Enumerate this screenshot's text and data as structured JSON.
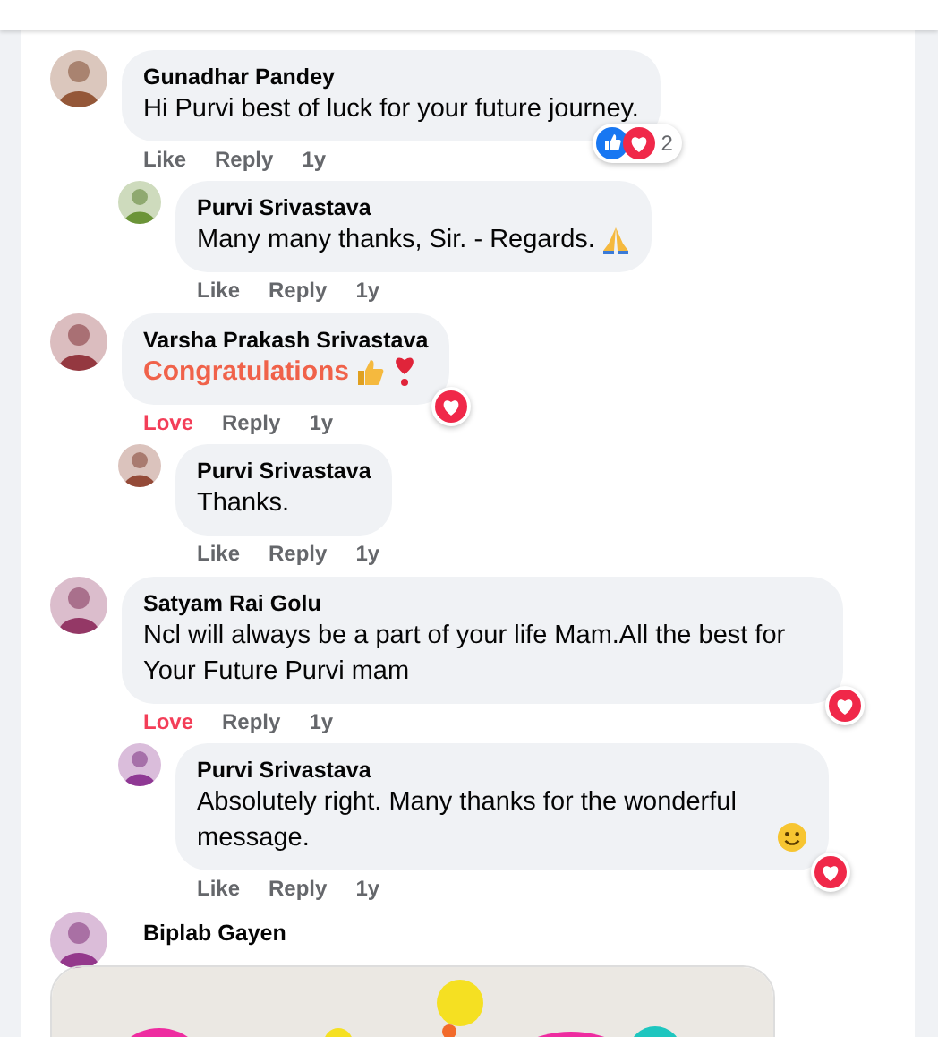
{
  "comments": [
    {
      "author": "Gunadhar Pandey",
      "text": "Hi Purvi best of luck for your future journey.",
      "emphasized": false,
      "react": {
        "label": "Like",
        "selected": false
      },
      "reply": "Reply",
      "time": "1y",
      "reactions": {
        "icons": [
          {
            "kind": "like"
          },
          {
            "kind": "love"
          }
        ],
        "count": "2"
      },
      "replies": [
        {
          "author": "Purvi Srivastava",
          "text": "Many many thanks, Sir. - Regards.",
          "emphasized": false,
          "emoji": [
            {
              "kind": "praying-hands"
            }
          ],
          "react": {
            "label": "Like",
            "selected": false
          },
          "reply": "Reply",
          "time": "1y"
        }
      ]
    },
    {
      "author": "Varsha Prakash Srivastava",
      "text": "Congratulations",
      "emphasized": true,
      "emoji": [
        {
          "kind": "thumbs-up"
        },
        {
          "kind": "heart"
        }
      ],
      "react": {
        "label": "Love",
        "selected": true
      },
      "reply": "Reply",
      "time": "1y",
      "reactions": {
        "icons": [
          {
            "kind": "love"
          }
        ]
      },
      "replies": [
        {
          "author": "Purvi Srivastava",
          "text": "Thanks.",
          "emphasized": false,
          "react": {
            "label": "Like",
            "selected": false
          },
          "reply": "Reply",
          "time": "1y"
        }
      ]
    },
    {
      "author": "Satyam Rai Golu",
      "text": "Ncl will always be a part of your life Mam.All the best for Your Future Purvi mam",
      "emphasized": false,
      "react": {
        "label": "Love",
        "selected": true
      },
      "reply": "Reply",
      "time": "1y",
      "reactions": {
        "icons": [
          {
            "kind": "love"
          }
        ]
      },
      "replies": [
        {
          "author": "Purvi Srivastava",
          "text": "Absolutely right. Many thanks for the wonderful message.",
          "emphasized": false,
          "emoji": [
            {
              "kind": "smiley"
            }
          ],
          "react": {
            "label": "Like",
            "selected": false
          },
          "reply": "Reply",
          "time": "1y",
          "reactions": {
            "icons": [
              {
                "kind": "love"
              }
            ]
          }
        }
      ]
    },
    {
      "author": "Biplab Gayen"
    }
  ]
}
